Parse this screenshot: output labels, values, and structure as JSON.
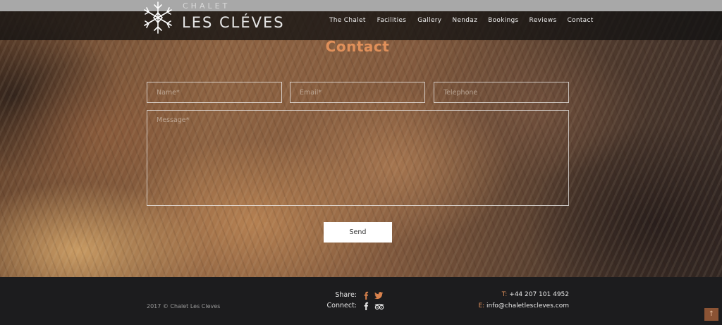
{
  "brand": {
    "name_small": "CHALET",
    "name_large": "LES CLÉVES"
  },
  "nav": {
    "items": [
      "The Chalet",
      "Facilities",
      "Gallery",
      "Nendaz",
      "Bookings",
      "Reviews",
      "Contact"
    ]
  },
  "contact": {
    "title": "Contact",
    "name_placeholder": "Name*",
    "email_placeholder": "Email*",
    "telephone_placeholder": "Telephone",
    "message_placeholder": "Message*",
    "send_label": "Send"
  },
  "footer": {
    "copyright": "2017 © Chalet Les Cleves",
    "share_label": "Share:",
    "connect_label": "Connect:",
    "share_icons": [
      "facebook-icon",
      "twitter-icon"
    ],
    "connect_icons": [
      "facebook-icon",
      "tripadvisor-icon"
    ],
    "tel_label": "T:",
    "tel_value": "+44 207 101 4952",
    "email_label": "E:",
    "email_value": "info@chaletlescleves.com",
    "back_to_top": "↑"
  },
  "colors": {
    "accent": "#e0905a",
    "footer_bg": "#1c1c1e",
    "nav_bg": "#121212"
  }
}
